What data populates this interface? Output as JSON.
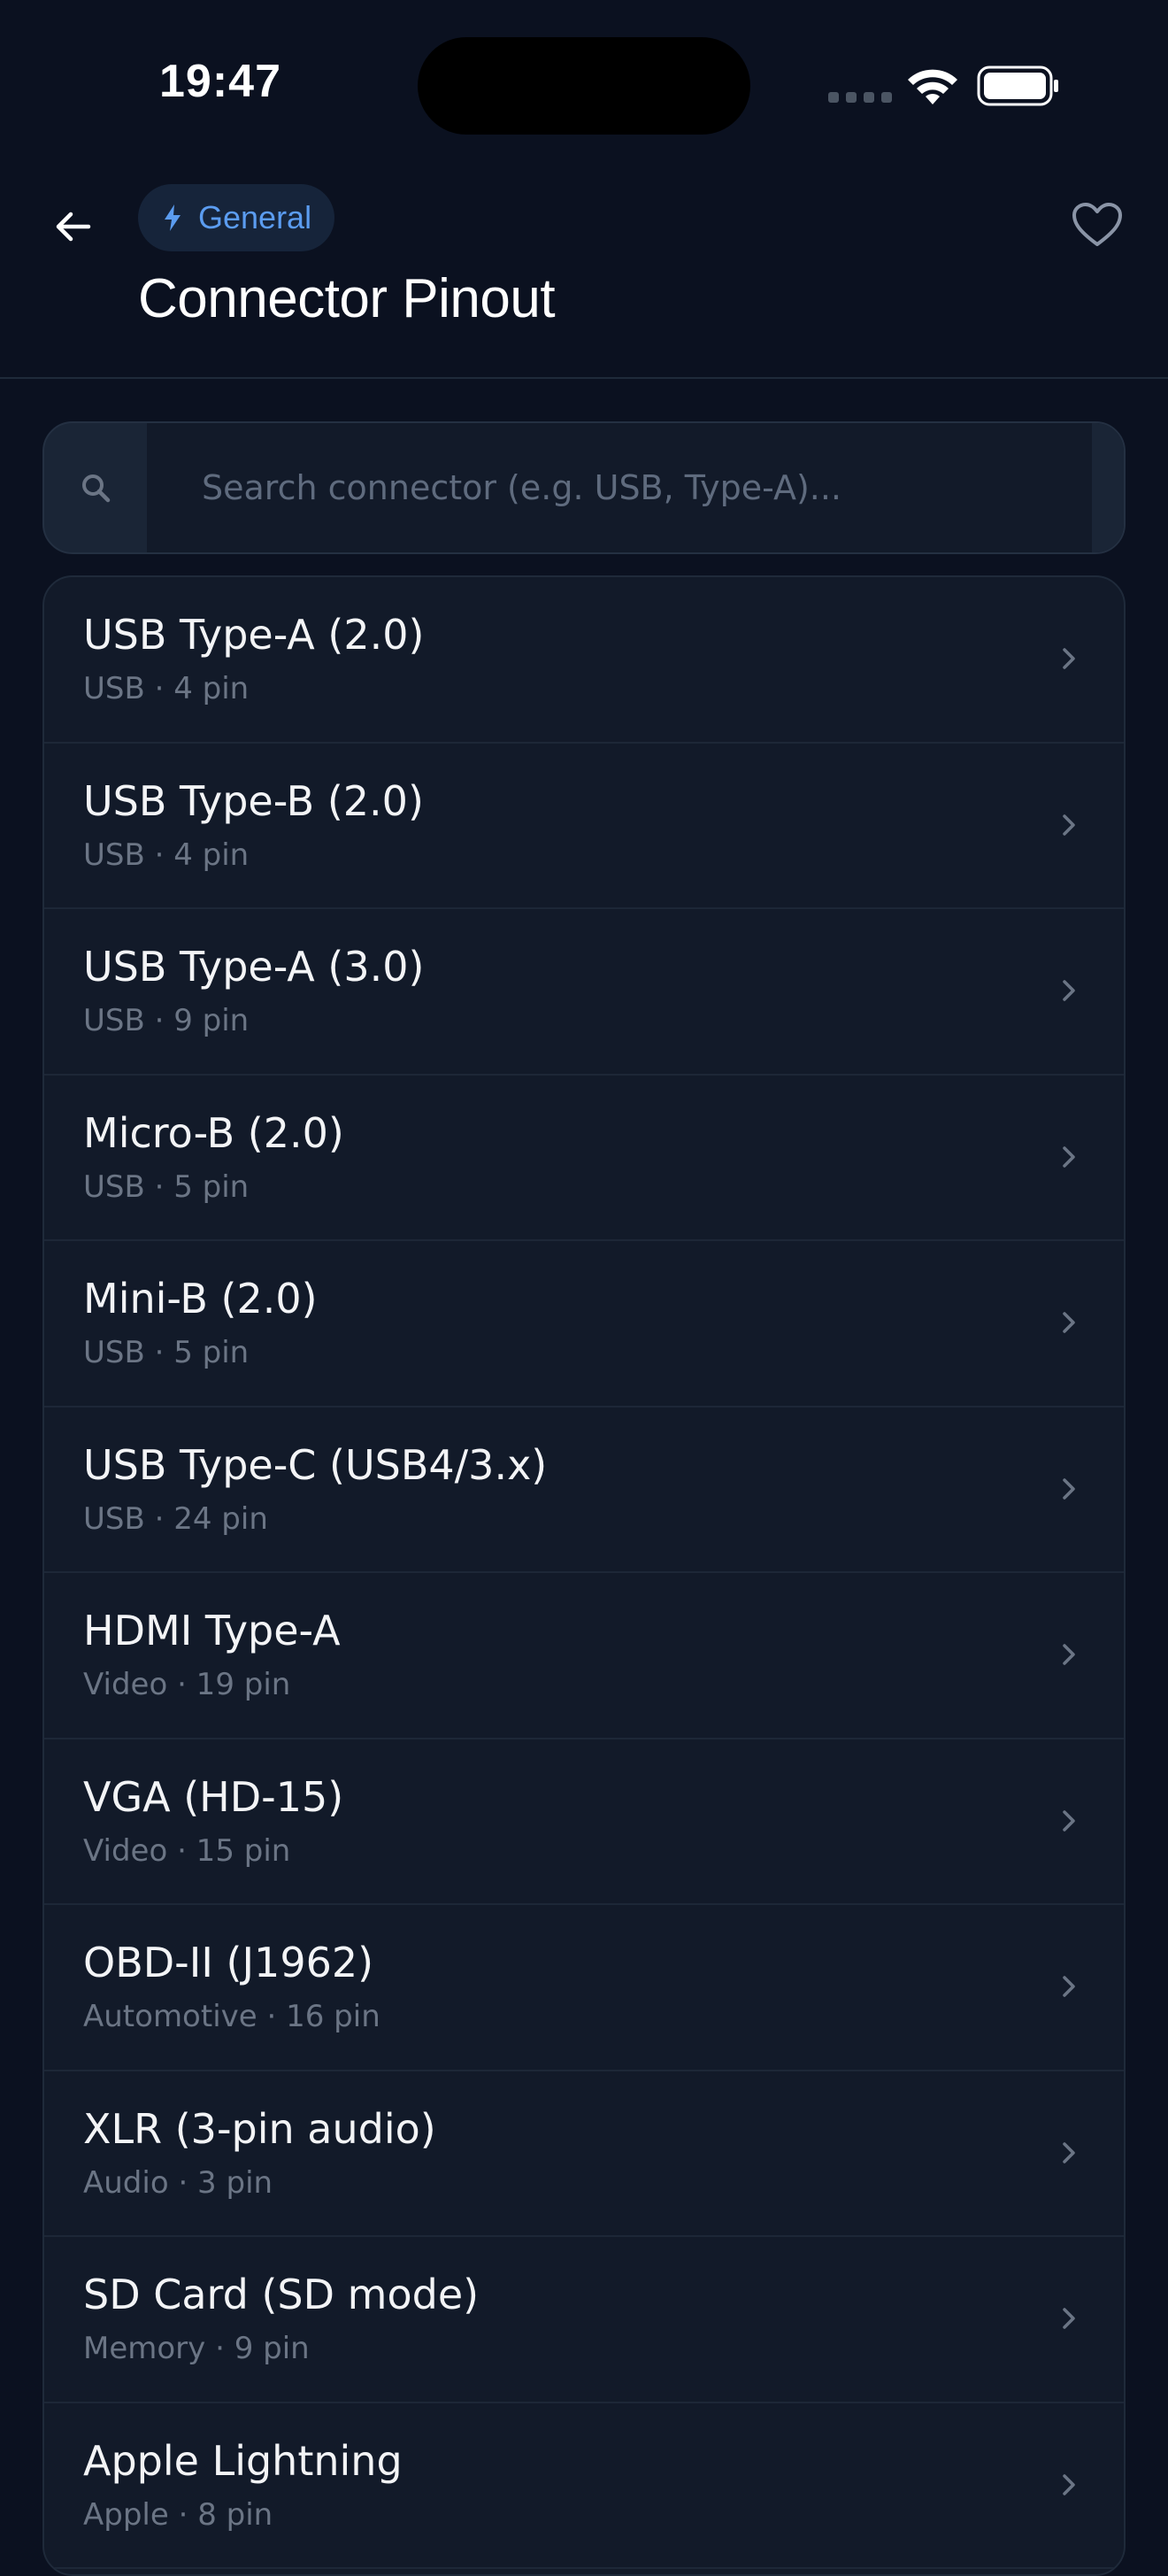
{
  "status_bar": {
    "time": "19:47"
  },
  "header": {
    "category_label": "General",
    "title": "Connector Pinout"
  },
  "search": {
    "placeholder": "Search connector (e.g. USB, Type-A)..."
  },
  "connectors": [
    {
      "name": "USB Type-A (2.0)",
      "meta": "USB · 4 pin"
    },
    {
      "name": "USB Type-B (2.0)",
      "meta": "USB · 4 pin"
    },
    {
      "name": "USB Type-A (3.0)",
      "meta": "USB · 9 pin"
    },
    {
      "name": "Micro-B (2.0)",
      "meta": "USB · 5 pin"
    },
    {
      "name": "Mini-B (2.0)",
      "meta": "USB · 5 pin"
    },
    {
      "name": "USB Type-C (USB4/3.x)",
      "meta": "USB · 24 pin"
    },
    {
      "name": "HDMI Type-A",
      "meta": "Video · 19 pin"
    },
    {
      "name": "VGA (HD-15)",
      "meta": "Video · 15 pin"
    },
    {
      "name": "OBD-II (J1962)",
      "meta": "Automotive · 16 pin"
    },
    {
      "name": "XLR (3-pin audio)",
      "meta": "Audio · 3 pin"
    },
    {
      "name": "SD Card (SD mode)",
      "meta": "Memory · 9 pin"
    },
    {
      "name": "Apple Lightning",
      "meta": "Apple · 8 pin"
    }
  ],
  "icons": {
    "back": "arrow-left-icon",
    "category": "lightning-bolt-icon",
    "favorite": "heart-icon",
    "search": "search-icon",
    "row": "chevron-right-icon"
  },
  "colors": {
    "background": "#0b1120",
    "card": "#121a29",
    "accent": "#5b9cf0",
    "chip": "#16243a"
  }
}
